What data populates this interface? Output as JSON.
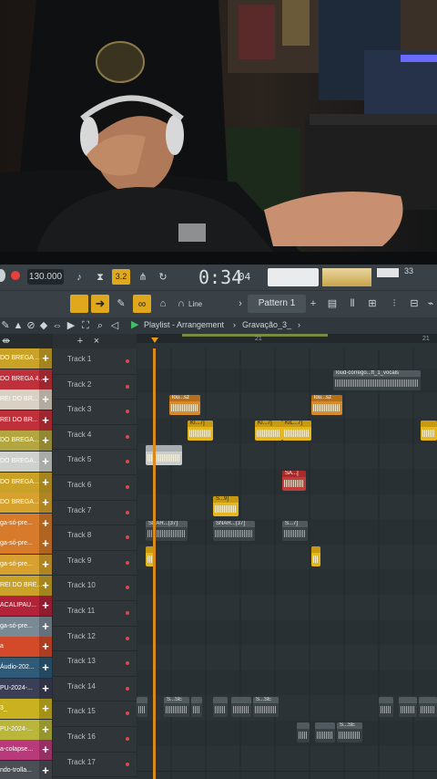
{
  "toolbar": {
    "tempo": "130.000",
    "time": "0:34",
    "time_small": "04",
    "pattern_label": "Pattern 1",
    "snap_label": "Line",
    "cpu_value": "33",
    "number_badge": "3.2"
  },
  "browser": {
    "breadcrumb": "Playlist - Arrangement",
    "breadcrumb_sep": "›",
    "arrangement_name": "Gravação_3_"
  },
  "ruler": {
    "marks": [
      "21",
      "21"
    ]
  },
  "patterns": [
    {
      "label": "DO BREGA ...",
      "color": "#c9a227"
    },
    {
      "label": "DO BREGA 4...",
      "color": "#c0303a"
    },
    {
      "label": "REI DO BR...",
      "color": "#d9d2c4"
    },
    {
      "label": "REI DO BR...",
      "color": "#c0303a"
    },
    {
      "label": "DO BREGA...",
      "color": "#b3a640"
    },
    {
      "label": "DO BREGA...",
      "color": "#cfd1cd"
    },
    {
      "label": "DO BREGA...",
      "color": "#c9a227"
    },
    {
      "label": "DO BREGA...",
      "color": "#d6a12e"
    },
    {
      "label": "ga-só-pre...",
      "color": "#d77b2a"
    },
    {
      "label": "ga-só-pre...",
      "color": "#d77b2a"
    },
    {
      "label": "ga-só-pre...",
      "color": "#d6a12e"
    },
    {
      "label": "REI DO BRE...",
      "color": "#c9a227"
    },
    {
      "label": "ACALIPAU...",
      "color": "#b2233a"
    },
    {
      "label": "ga-só-pre...",
      "color": "#7a8a95"
    },
    {
      "label": "a",
      "color": "#d24a2a"
    },
    {
      "label": "Áudio-202...",
      "color": "#2f5a78"
    },
    {
      "label": "PU-2024-...",
      "color": "#3a3f55"
    },
    {
      "label": "3_",
      "color": "#c9b11f"
    },
    {
      "label": "PU-2024-...",
      "color": "#b9b63a"
    },
    {
      "label": "a-colapse...",
      "color": "#b83a7a"
    },
    {
      "label": "ndo-trolla...",
      "color": "#4a4f55"
    }
  ],
  "tracks": [
    {
      "name": "Track 1"
    },
    {
      "name": "Track 2"
    },
    {
      "name": "Track 3"
    },
    {
      "name": "Track 4"
    },
    {
      "name": "Track 5"
    },
    {
      "name": "Track 6"
    },
    {
      "name": "Track 7"
    },
    {
      "name": "Track 8"
    },
    {
      "name": "Track 9"
    },
    {
      "name": "Track 10"
    },
    {
      "name": "Track 11"
    },
    {
      "name": "Track 12"
    },
    {
      "name": "Track 13"
    },
    {
      "name": "Track 14"
    },
    {
      "name": "Track 15"
    },
    {
      "name": "Track 16"
    },
    {
      "name": "Track 17"
    }
  ],
  "clips": [
    {
      "track": 2,
      "start": 216,
      "len": 96,
      "style": "dk",
      "label": "loud-corrego...ft_1_vocals"
    },
    {
      "track": 3,
      "start": 36,
      "len": 34,
      "style": "or",
      "label": "lou...sz"
    },
    {
      "track": 3,
      "start": 192,
      "len": 34,
      "style": "or",
      "label": "lou...sz"
    },
    {
      "track": 4,
      "start": 56,
      "len": 28,
      "style": "yl",
      "label": "KI...7]"
    },
    {
      "track": 4,
      "start": 130,
      "len": 30,
      "style": "yl",
      "label": "KI...7]"
    },
    {
      "track": 4,
      "start": 160,
      "len": 32,
      "style": "yl",
      "label": "KIL...7]"
    },
    {
      "track": 4,
      "start": 312,
      "len": 18,
      "style": "yl",
      "label": ""
    },
    {
      "track": 5,
      "start": 10,
      "len": 40,
      "style": "wt",
      "label": ""
    },
    {
      "track": 6,
      "start": 160,
      "len": 26,
      "style": "rd",
      "label": "SA...]"
    },
    {
      "track": 7,
      "start": 84,
      "len": 28,
      "style": "yl",
      "label": "S...9]"
    },
    {
      "track": 8,
      "start": 10,
      "len": 46,
      "style": "dk",
      "label": "SNAR...(37]"
    },
    {
      "track": 8,
      "start": 84,
      "len": 46,
      "style": "dk",
      "label": "SNAR...(37]"
    },
    {
      "track": 8,
      "start": 160,
      "len": 28,
      "style": "dk",
      "label": "S...7]"
    },
    {
      "track": 9,
      "start": 10,
      "len": 10,
      "style": "yl",
      "label": ""
    },
    {
      "track": 9,
      "start": 192,
      "len": 10,
      "style": "yl",
      "label": ""
    },
    {
      "track": 15,
      "start": 0,
      "len": 12,
      "style": "dk",
      "label": ""
    },
    {
      "track": 15,
      "start": 30,
      "len": 28,
      "style": "dk",
      "label": "S...SE"
    },
    {
      "track": 15,
      "start": 60,
      "len": 12,
      "style": "dk",
      "label": ""
    },
    {
      "track": 15,
      "start": 84,
      "len": 16,
      "style": "dk",
      "label": ""
    },
    {
      "track": 15,
      "start": 104,
      "len": 22,
      "style": "dk",
      "label": ""
    },
    {
      "track": 15,
      "start": 128,
      "len": 28,
      "style": "dk",
      "label": "S...SE"
    },
    {
      "track": 15,
      "start": 266,
      "len": 16,
      "style": "dk",
      "label": ""
    },
    {
      "track": 15,
      "start": 288,
      "len": 20,
      "style": "dk",
      "label": ""
    },
    {
      "track": 15,
      "start": 310,
      "len": 20,
      "style": "dk",
      "label": ""
    },
    {
      "track": 16,
      "start": 176,
      "len": 14,
      "style": "dk",
      "label": ""
    },
    {
      "track": 16,
      "start": 196,
      "len": 22,
      "style": "dk",
      "label": ""
    },
    {
      "track": 16,
      "start": 220,
      "len": 28,
      "style": "dk",
      "label": "S...SE"
    }
  ]
}
